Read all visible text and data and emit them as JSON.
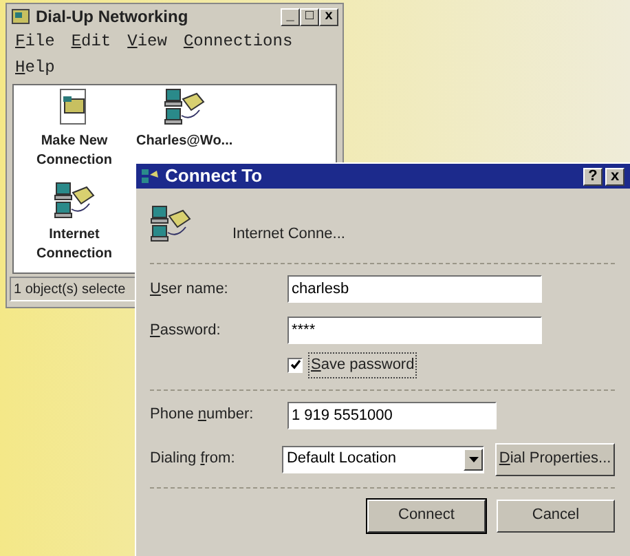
{
  "main_window": {
    "title": "Dial-Up Networking",
    "controls": [
      "_",
      "□",
      "x"
    ],
    "menu": [
      {
        "key": "F",
        "post": "ile"
      },
      {
        "key": "E",
        "post": "dit"
      },
      {
        "key": "V",
        "post": "iew"
      },
      {
        "key": "C",
        "post": "onnections"
      },
      {
        "key": "H",
        "post": "elp"
      }
    ],
    "items": [
      {
        "kind": "new",
        "label": "Make New Connection"
      },
      {
        "kind": "connection",
        "label": "Charles@Wo..."
      },
      {
        "kind": "connection",
        "label": "Internet Connection"
      }
    ],
    "status_bar": "1 object(s) selecte"
  },
  "dialog": {
    "title": "Connect To",
    "controls": [
      "?",
      "x"
    ],
    "connection_name": "Internet Conne...",
    "user_name": {
      "label": {
        "key": "U",
        "post": "ser name:"
      },
      "value": "charlesb"
    },
    "password": {
      "label": {
        "key": "P",
        "post": "assword:"
      },
      "value": "****"
    },
    "save_password": {
      "label": {
        "key": "S",
        "post": "ave password"
      },
      "checked": true
    },
    "phone_number": {
      "label": {
        "pre": "Phone ",
        "key": "n",
        "post": "umber:"
      },
      "value": "1 919 5551000"
    },
    "dialing_from": {
      "label": {
        "pre": "Dialing ",
        "key": "f",
        "post": "rom:"
      },
      "value": "Default Location"
    },
    "dial_properties": {
      "key": "D",
      "post": "ial Properties..."
    },
    "buttons": [
      "Connect",
      "Cancel"
    ]
  }
}
